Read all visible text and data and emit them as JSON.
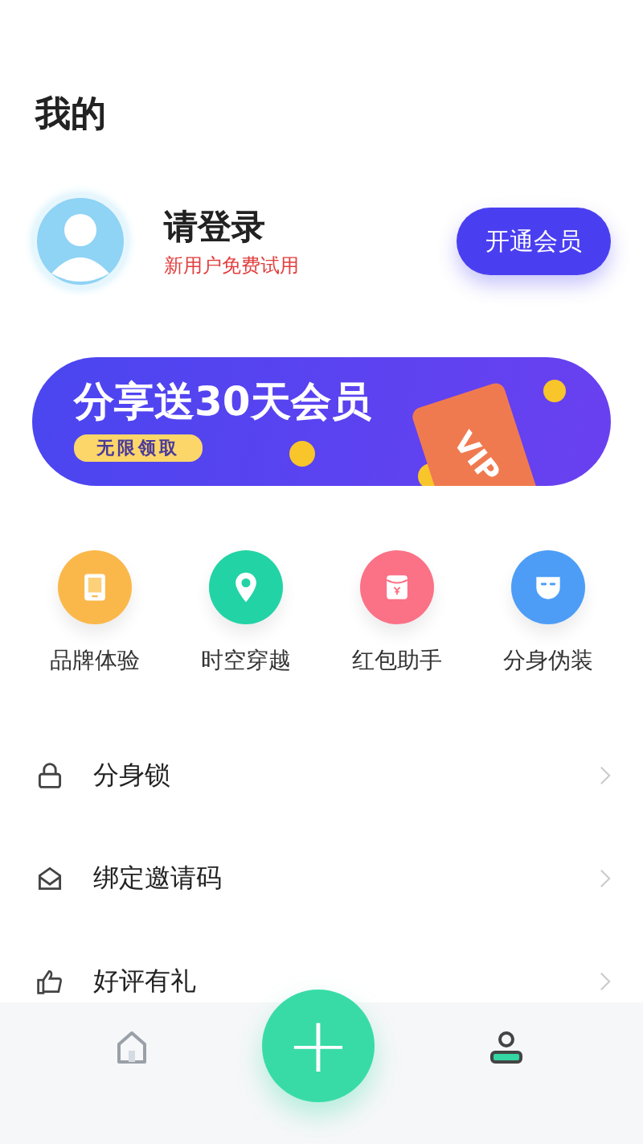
{
  "page_title": "我的",
  "profile": {
    "name": "请登录",
    "subtitle": "新用户免费试用",
    "button": "开通会员"
  },
  "banner": {
    "headline": "分享送30天会员",
    "tag": "无限领取",
    "card_text": "VIP"
  },
  "shortcuts": [
    {
      "label": "品牌体验",
      "kind": "phone",
      "color": "#fbb84a"
    },
    {
      "label": "时空穿越",
      "kind": "pin",
      "color": "#22d3a5"
    },
    {
      "label": "红包助手",
      "kind": "envelope",
      "color": "#fb7186"
    },
    {
      "label": "分身伪装",
      "kind": "mask",
      "color": "#4d9df7"
    }
  ],
  "menu": [
    {
      "label": "分身锁",
      "kind": "lock"
    },
    {
      "label": "绑定邀请码",
      "kind": "invite"
    },
    {
      "label": "好评有礼",
      "kind": "thumb"
    }
  ],
  "tabs": [
    {
      "kind": "home",
      "selected": false
    },
    {
      "kind": "profile",
      "selected": true
    }
  ],
  "fab": "+"
}
